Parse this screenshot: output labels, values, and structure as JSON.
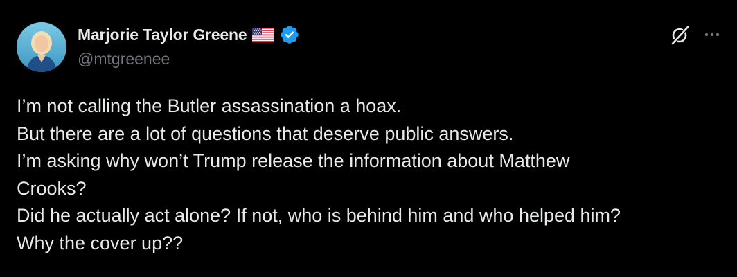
{
  "author": {
    "display_name": "Marjorie Taylor Greene",
    "flag_icon": "us-flag-icon",
    "verified_icon": "verified-badge-icon",
    "handle": "@mtgreenee"
  },
  "actions": {
    "grok_icon": "grok-icon",
    "more_icon": "more-options-icon"
  },
  "tweet": {
    "lines": [
      "I’m not calling the Butler assassination a hoax.",
      "But there are a lot of questions that deserve public answers.",
      "I’m asking why won’t Trump release the information about Matthew",
      "Crooks?",
      "Did he actually act alone? If not, who is behind him and who helped him?",
      "Why the cover up??"
    ]
  },
  "colors": {
    "background": "#000000",
    "text": "#e7e9ea",
    "secondary": "#71767b",
    "verified": "#1d9bf0"
  }
}
